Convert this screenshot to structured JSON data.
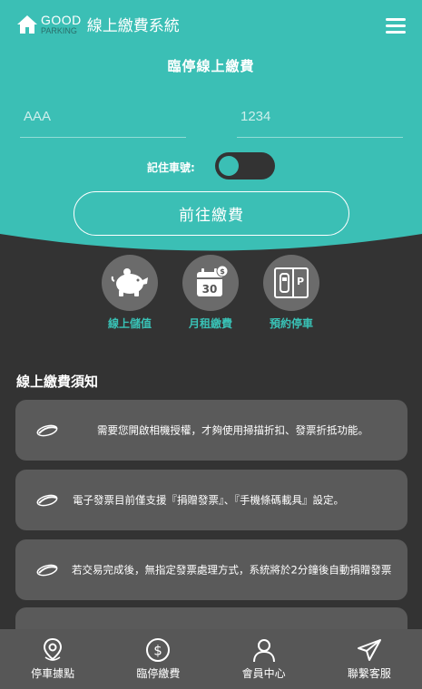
{
  "app": {
    "brand_top": "GOOD",
    "brand_bottom": "PARKING",
    "title": "線上繳費系統"
  },
  "page": {
    "title": "臨停線上繳費"
  },
  "form": {
    "plate_letters_placeholder": "AAA",
    "plate_numbers_placeholder": "1234",
    "plate_letters_value": "",
    "plate_numbers_value": "",
    "remember_label": "記住車號:",
    "remember_on": false,
    "submit_label": "前往繳費"
  },
  "features": [
    {
      "label": "線上儲值",
      "icon": "piggy-bank-icon"
    },
    {
      "label": "月租繳費",
      "icon": "calendar-dollar-icon"
    },
    {
      "label": "預約停車",
      "icon": "parking-reserve-icon"
    }
  ],
  "notice": {
    "title": "線上繳費須知",
    "items": [
      "需要您開啟相機授權，才夠使用掃描折扣、發票折抵功能。",
      "電子發票目前僅支援『捐贈發票』、『手機條碼載具』設定。",
      "若交易完成後，無指定發票處理方式，系統將於2分鐘後自動捐贈發票",
      ""
    ]
  },
  "bottom_nav": [
    {
      "label": "停車據點",
      "icon": "location-pin-icon"
    },
    {
      "label": "臨停繳費",
      "icon": "dollar-circle-icon"
    },
    {
      "label": "會員中心",
      "icon": "user-icon"
    },
    {
      "label": "聯繫客服",
      "icon": "paper-plane-icon"
    }
  ],
  "colors": {
    "teal": "#3bbfb5",
    "dark_bg": "#333333",
    "card_bg": "#5a5a5a",
    "nav_bg": "#575757",
    "accent_label": "#39c2b6"
  }
}
